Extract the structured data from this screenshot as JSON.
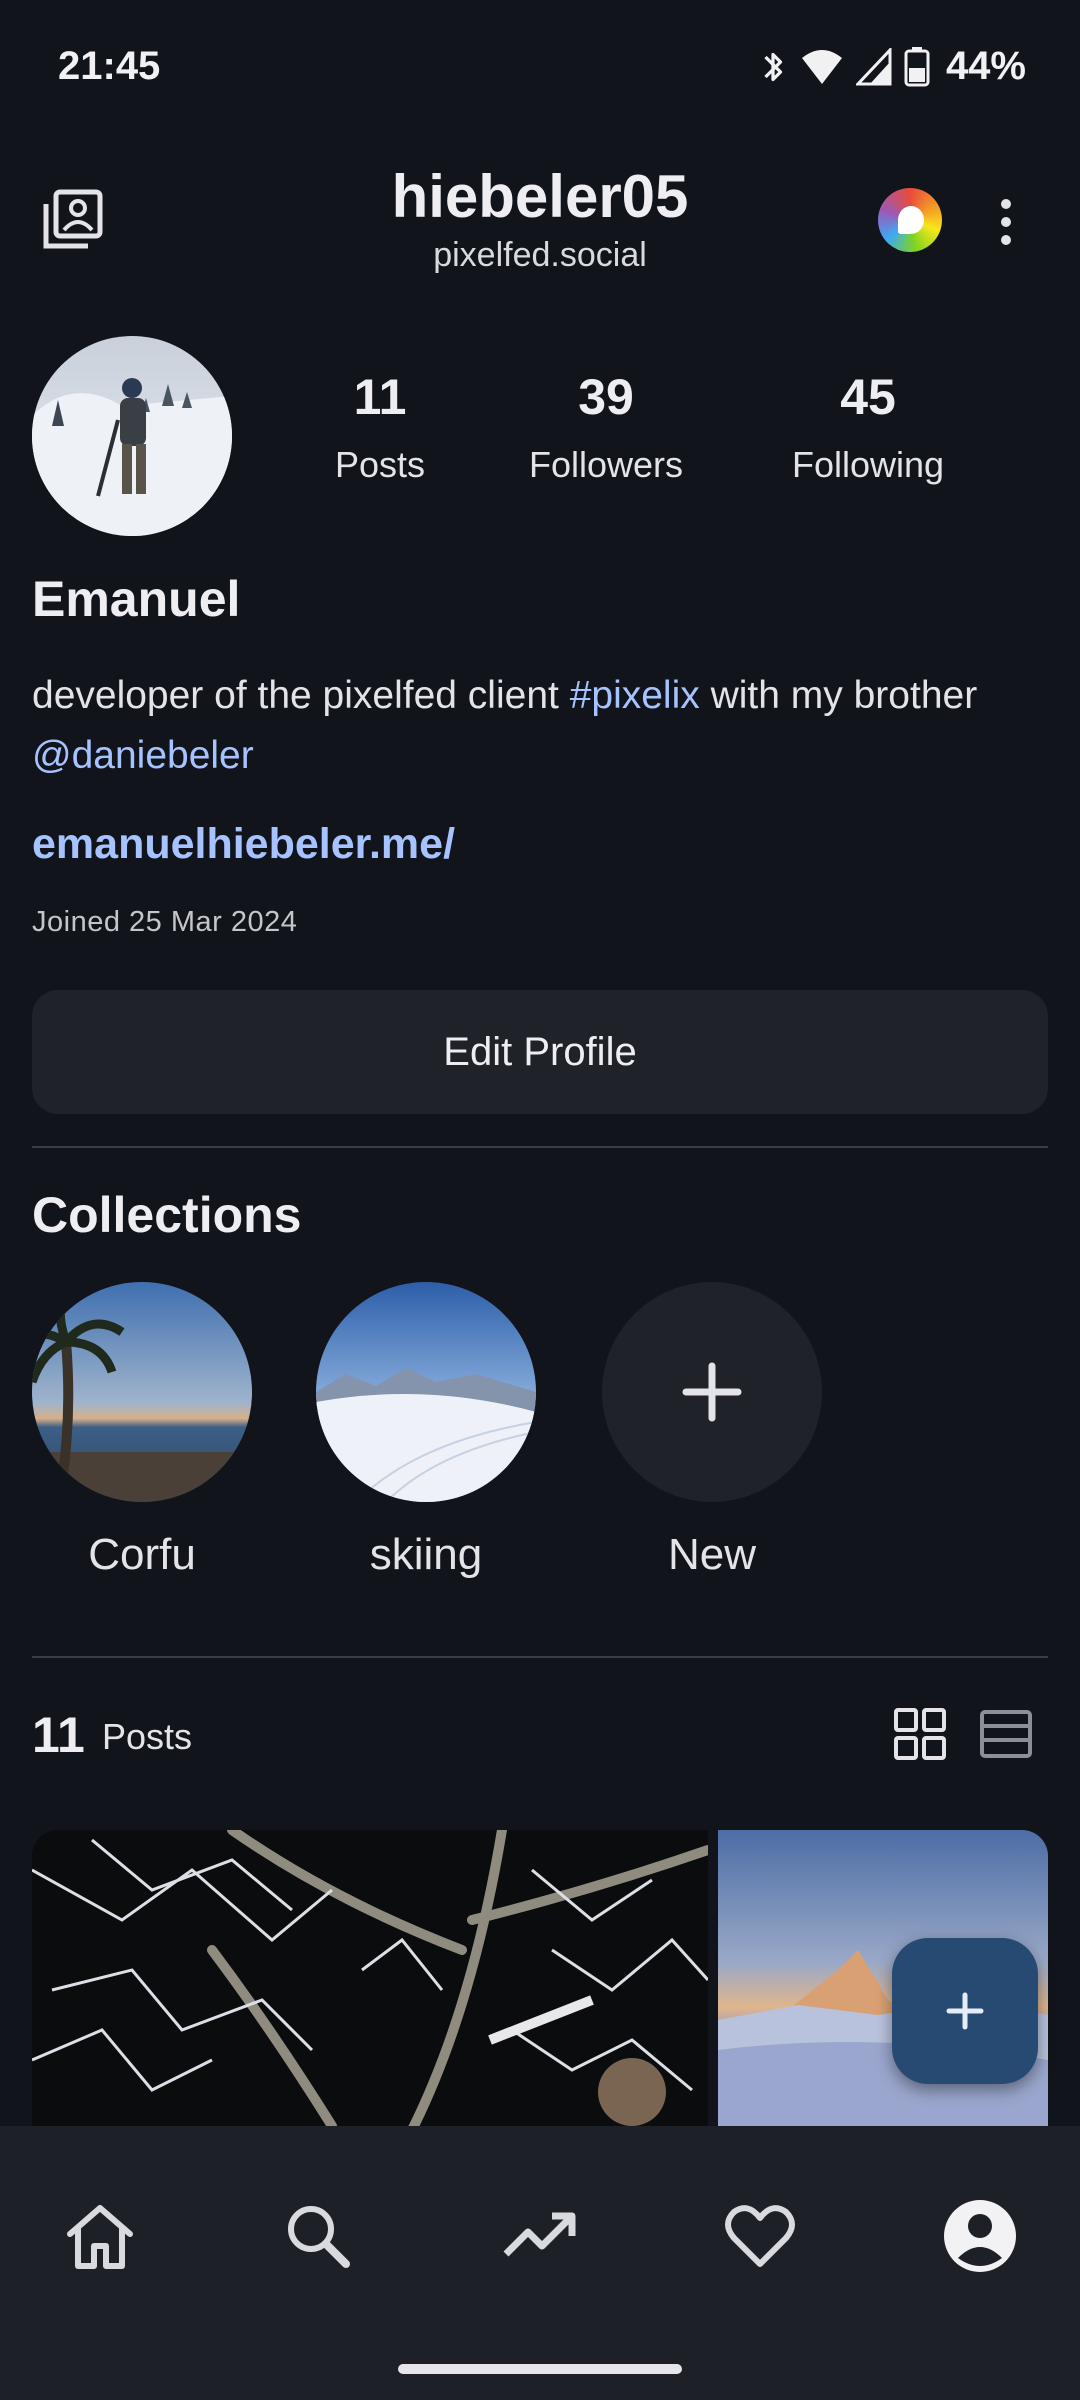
{
  "status_bar": {
    "time": "21:45",
    "battery": "44%"
  },
  "header": {
    "username": "hiebeler05",
    "instance": "pixelfed.social"
  },
  "profile": {
    "stats": [
      {
        "value": "11",
        "label": "Posts"
      },
      {
        "value": "39",
        "label": "Followers"
      },
      {
        "value": "45",
        "label": "Following"
      }
    ],
    "display_name": "Emanuel",
    "bio_prefix": "developer of the pixelfed client ",
    "bio_hashtag": "#pixelix",
    "bio_middle": " with my brother",
    "bio_mention": "@daniebeler",
    "website": "emanuelhiebeler.me/",
    "joined": "Joined 25 Mar 2024",
    "edit_button": "Edit Profile"
  },
  "collections": {
    "title": "Collections",
    "items": [
      {
        "label": "Corfu"
      },
      {
        "label": "skiing"
      },
      {
        "label": "New"
      }
    ]
  },
  "posts": {
    "count": "11",
    "label": "Posts"
  },
  "colors": {
    "background": "#11141b",
    "link": "#a6c3ff",
    "surface": "#1f2229",
    "fab": "#274a72"
  },
  "icons": {
    "header_left": "collections-icon",
    "header_right": [
      "pixelfed-logo-icon",
      "more-vert-icon"
    ],
    "view_toggle": [
      "grid-view-icon",
      "list-view-icon"
    ],
    "fab": "plus-icon",
    "bottom_nav": [
      "home-icon",
      "search-icon",
      "trending-icon",
      "heart-icon",
      "account-icon"
    ]
  }
}
